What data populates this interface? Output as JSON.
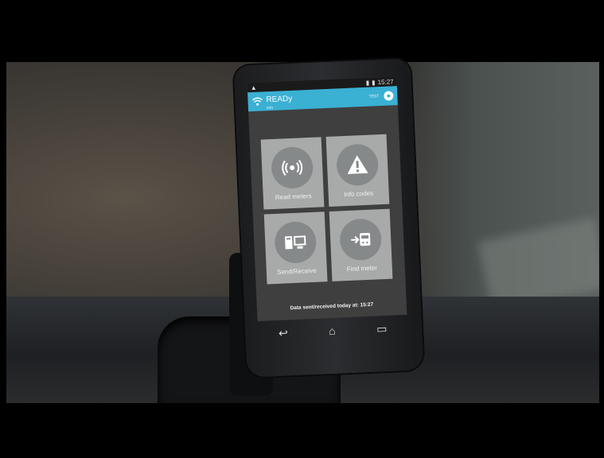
{
  "app": {
    "title": "READy",
    "subtitle": "Info",
    "right_label": "TEST",
    "status_time": "15:27"
  },
  "tiles": [
    {
      "label": "Read meters",
      "icon": "wireless-icon"
    },
    {
      "label": "Info codes",
      "icon": "warning-icon"
    },
    {
      "label": "Send/Receive",
      "icon": "computer-icon"
    },
    {
      "label": "Find meter",
      "icon": "find-meter-icon"
    }
  ],
  "footer": {
    "status_text": "Data sent/received today at: 15:27"
  },
  "colors": {
    "appbar": "#3ab0d3",
    "tile": "#a7aaa8",
    "tile_circle": "#86898a"
  }
}
